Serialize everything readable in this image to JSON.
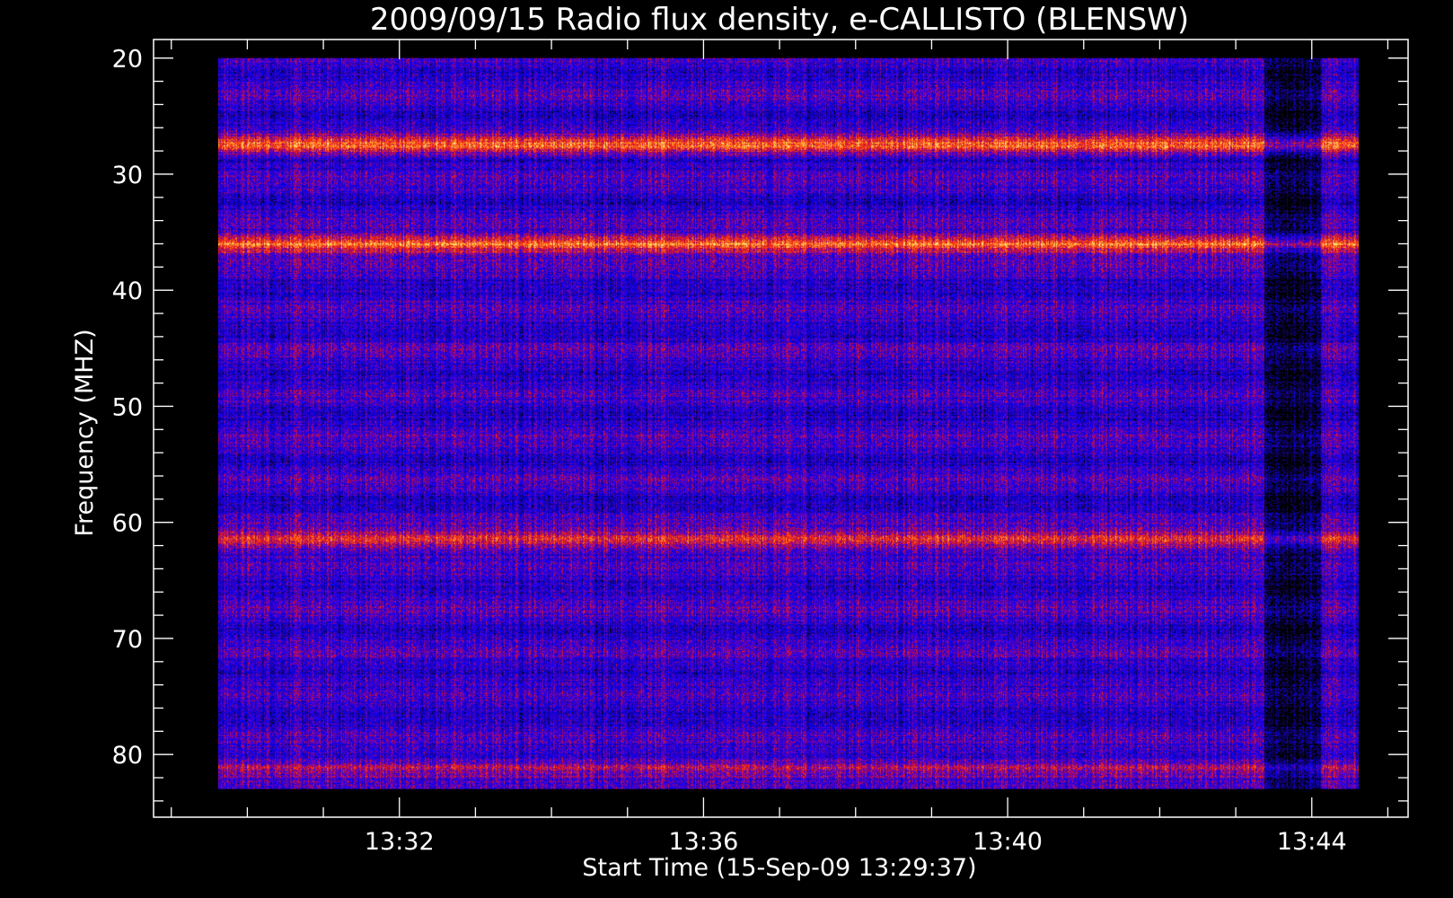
{
  "chart_data": {
    "type": "heatmap",
    "title": "2009/09/15  Radio flux density, e-CALLISTO (BLENSW)",
    "xlabel": "Start Time (15-Sep-09 13:29:37)",
    "ylabel": "Frequency (MHZ)",
    "x_ticks": [
      "13:32",
      "13:36",
      "13:40",
      "13:44"
    ],
    "x_tick_minutes": [
      2.3833,
      6.3833,
      10.3833,
      14.3833
    ],
    "xlim_minutes": [
      -0.85,
      15.65
    ],
    "data_x_range_minutes": [
      0.0,
      15.0
    ],
    "y_ticks": [
      20,
      30,
      40,
      50,
      60,
      70,
      80
    ],
    "ylim": [
      18.4,
      85.4
    ],
    "data_y_range": [
      20,
      83
    ],
    "y_inverted": true,
    "colormap": [
      "#000000",
      "#1a00a0",
      "#0000ff",
      "#6a00c0",
      "#d0102a",
      "#ff3a10",
      "#ffb030",
      "#ffffa0"
    ],
    "bright_bands_mhz": [
      {
        "center": 27.5,
        "intensity": 0.78
      },
      {
        "center": 36.0,
        "intensity": 0.95
      },
      {
        "center": 61.5,
        "intensity": 0.7
      },
      {
        "center": 81.0,
        "intensity": 0.45
      }
    ],
    "dark_gap_minutes": [
      13.75,
      14.5
    ],
    "background_color": "#000000",
    "axis_color": "#ffffff"
  }
}
